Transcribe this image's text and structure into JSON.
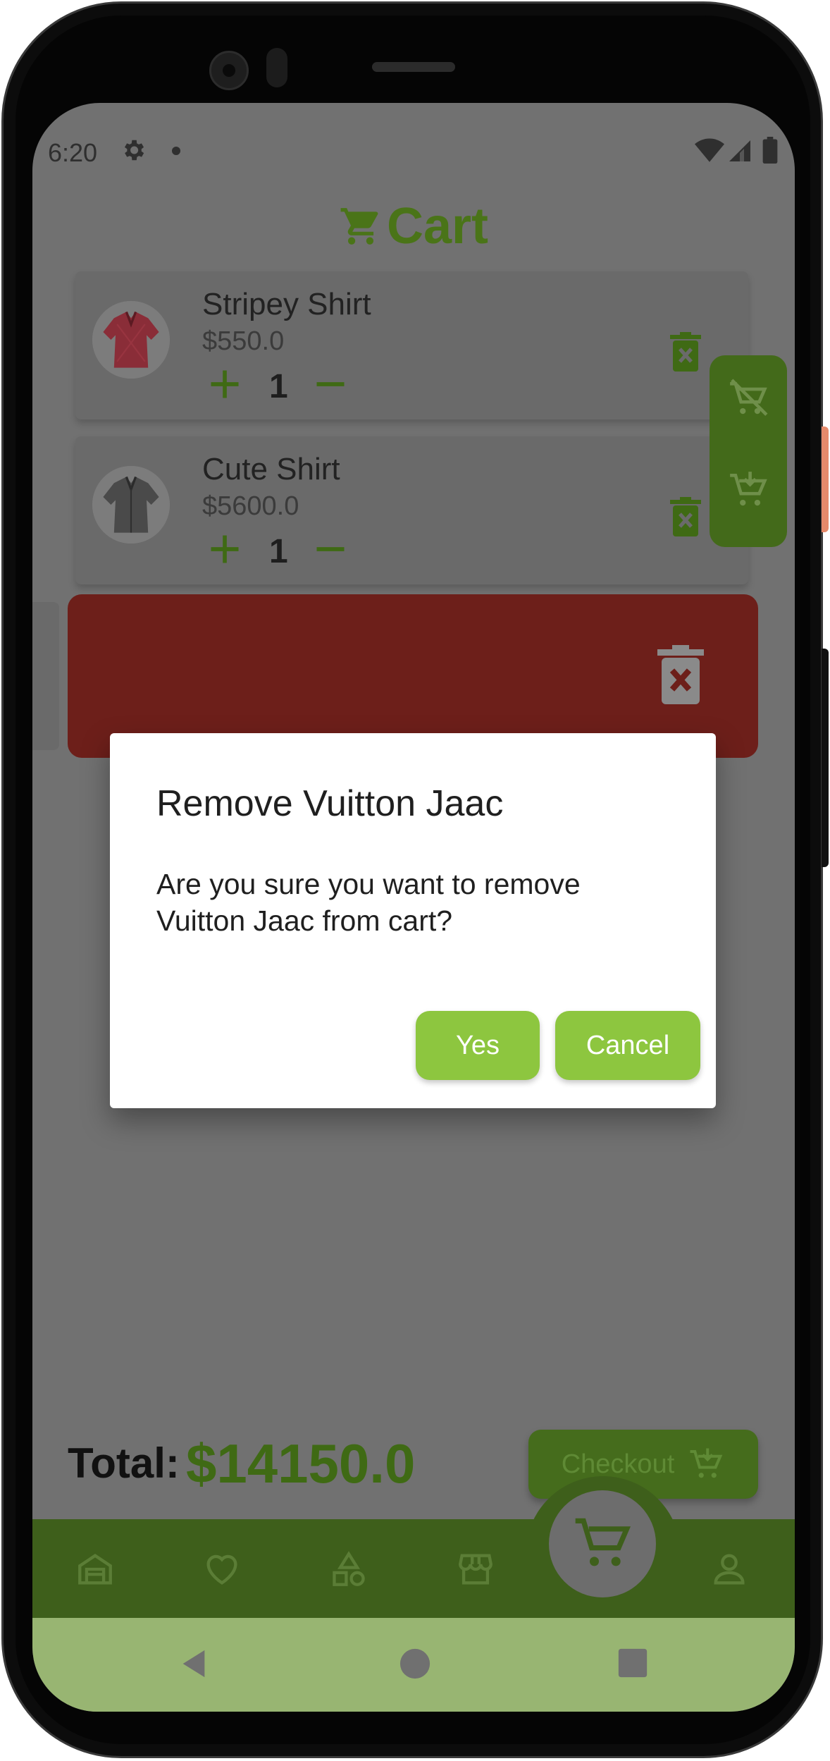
{
  "status_bar": {
    "time": "6:20"
  },
  "header": {
    "title": "Cart"
  },
  "cart_items": [
    {
      "name": "Stripey Shirt",
      "price": "$550.0",
      "quantity": "1"
    },
    {
      "name": "Cute Shirt",
      "price": "$5600.0",
      "quantity": "1"
    }
  ],
  "footer": {
    "total_label": "Total:",
    "total_value": "$14150.0",
    "checkout_label": "Checkout"
  },
  "dialog": {
    "title": "Remove Vuitton Jaac",
    "message": "Are you sure you want to remove Vuitton Jaac from cart?",
    "yes_label": "Yes",
    "cancel_label": "Cancel"
  },
  "colors": {
    "accent_green": "#8dc63f",
    "dark_green": "#3e5f1b",
    "delete_red": "#6d1f1a",
    "scrim_gray": "#717171"
  }
}
